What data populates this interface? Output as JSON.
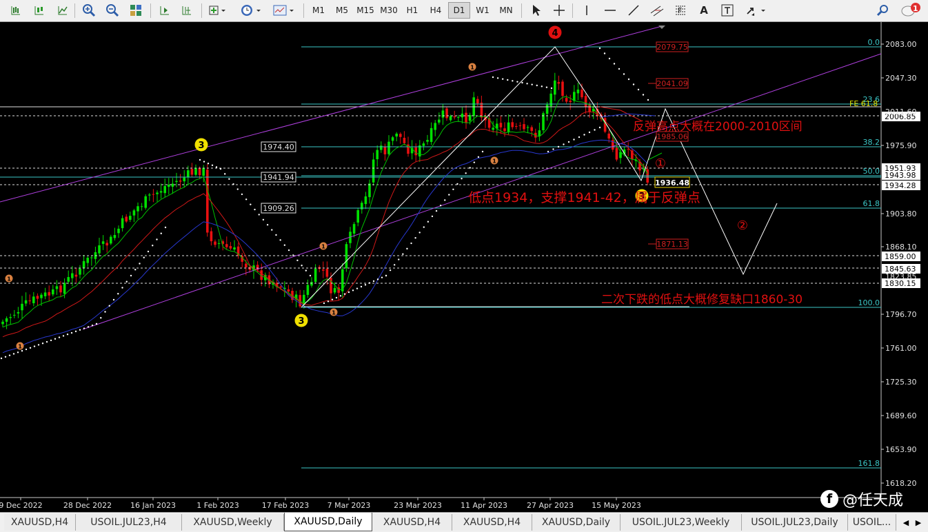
{
  "toolbar": {
    "timeframes": [
      "M1",
      "M5",
      "M15",
      "M30",
      "H1",
      "H4",
      "D1",
      "W1",
      "MN"
    ],
    "active_timeframe": "D1",
    "text_tool_label": "A",
    "notification_count": "1",
    "icons": [
      "bar-chart-icon",
      "candlestick-icon",
      "line-chart-icon",
      "zoom-in-icon",
      "zoom-out-icon",
      "tile-windows-icon",
      "autoscroll-icon",
      "chart-shift-icon",
      "add-indicator-icon",
      "periods-icon",
      "templates-icon",
      "cursor-icon",
      "crosshair-icon",
      "vertical-line-icon",
      "horizontal-line-icon",
      "trendline-icon",
      "channel-icon",
      "fibonacci-icon",
      "text-icon",
      "text-label-icon",
      "arrows-icon",
      "search-icon",
      "notification-icon"
    ]
  },
  "chart": {
    "symbol": "XAUUSD,Daily",
    "price_scale_labels": [
      "2083.00",
      "2047.30",
      "1975.90",
      "1903.80",
      "1868.10",
      "1796.70",
      "1761.00",
      "1725.30",
      "1689.60",
      "1653.90",
      "1618.20"
    ],
    "highlighted_price_labels": [
      "2006.85",
      "1951.93",
      "1943.98",
      "1934.28",
      "1859.00",
      "1845.63",
      "1830.15"
    ],
    "partial_price_labels": [
      "2011.60",
      "1823.85"
    ],
    "date_labels": [
      "9 Dec 2022",
      "28 Dec 2022",
      "16 Jan 2023",
      "1 Feb 2023",
      "17 Feb 2023",
      "7 Mar 2023",
      "23 Mar 2023",
      "11 Apr 2023",
      "27 Apr 2023",
      "15 May 2023"
    ],
    "fib_levels": [
      "0.0",
      "23.6",
      "38.2",
      "50.0",
      "61.8",
      "100.0",
      "161.8"
    ],
    "fe_label": "FE 61.8",
    "price_boxes": [
      "1974.40",
      "1941.94",
      "1909.26"
    ],
    "red_price_boxes": [
      "2079.75",
      "2041.09",
      "1985.06",
      "1871.13"
    ],
    "current_price": "1936.48",
    "wave_labels": {
      "four": "4",
      "three": "3",
      "one": "1"
    },
    "circle_markers": [
      "①",
      "②"
    ],
    "annotations": {
      "rebound": "反弹高点大概在2000-2010区间",
      "low_support": "低点1934，支撑1941-42，属于反弹点",
      "second_drop": "二次下跌的低点大概修复缺口1860-30"
    }
  },
  "tabs": [
    "XAUUSD,H4",
    "USOIL.JUL23,H4",
    "XAUUSD,Weekly",
    "XAUUSD,Daily",
    "XAUUSD,H4",
    "XAUUSD,H4",
    "XAUUSD,Daily",
    "USOIL.JUL23,Weekly",
    "USOIL.JUL23,Daily",
    "USOIL..."
  ],
  "active_tab": "XAUUSD,Daily",
  "watermark": "@任天成",
  "watermark_icon": "facebook-icon"
}
